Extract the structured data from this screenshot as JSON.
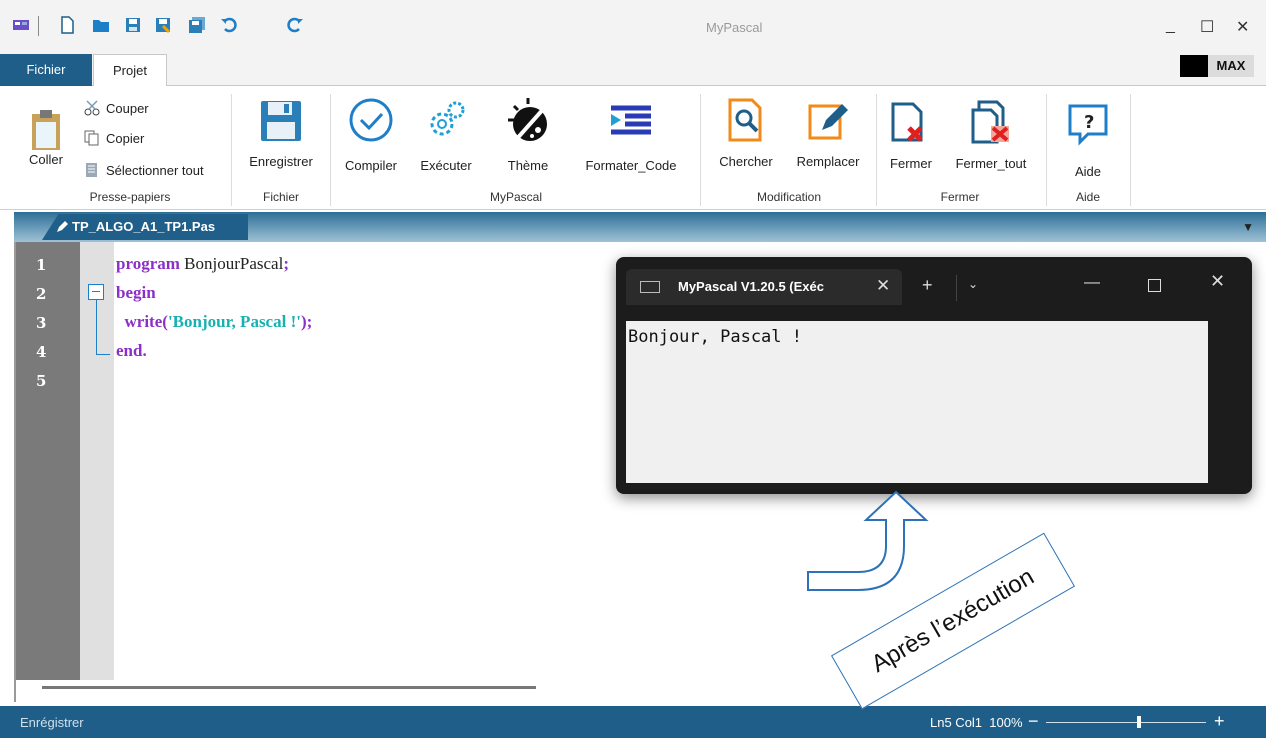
{
  "window": {
    "title": "MyPascal",
    "max_label": "MAX",
    "controls": {
      "minimize": "_",
      "maximize": "☐",
      "close": "✕"
    }
  },
  "quick_access": [
    {
      "name": "app-logo-icon"
    },
    {
      "name": "new-file-icon"
    },
    {
      "name": "open-folder-icon"
    },
    {
      "name": "save-icon"
    },
    {
      "name": "save-as-icon"
    },
    {
      "name": "save-all-icon"
    },
    {
      "name": "undo-icon"
    },
    {
      "name": "redo-icon"
    }
  ],
  "menu_tabs": {
    "fichier": "Fichier",
    "projet": "Projet"
  },
  "ribbon": {
    "clipboard": {
      "coller": "Coller",
      "couper": "Couper",
      "copier": "Copier",
      "selectionner": "Sélectionner tout",
      "group": "Presse-papiers"
    },
    "fichier": {
      "enregistrer": "Enregistrer",
      "group": "Fichier"
    },
    "mypascal": {
      "compiler": "Compiler",
      "executer": "Exécuter",
      "theme": "Thème",
      "formater": "Formater_Code",
      "group": "MyPascal"
    },
    "modification": {
      "chercher": "Chercher",
      "remplacer": "Remplacer",
      "group": "Modification"
    },
    "fermer": {
      "fermer": "Fermer",
      "fermer_tout": "Fermer_tout",
      "group": "Fermer"
    },
    "aide": {
      "aide": "Aide",
      "group": "Aide"
    }
  },
  "document_tab": {
    "filename": "TP_ALGO_A1_TP1.Pas"
  },
  "editor": {
    "line_numbers": [
      "1",
      "2",
      "3",
      "4",
      "5"
    ],
    "code": {
      "l1_kw": "program",
      "l1_id": " BonjourPascal",
      "l1_pun": ";",
      "l2_kw": "begin",
      "l3_kw": "  write",
      "l3_p1": "(",
      "l3_str": "'Bonjour, Pascal !'",
      "l3_p2": ");",
      "l4_kw": "end",
      "l4_pun": "."
    }
  },
  "status_bar": {
    "left": "Enrégistrer",
    "position": "Ln5 Col1",
    "zoom": "100%",
    "zoom_level": 0.58
  },
  "terminal": {
    "tab_title": "MyPascal V1.20.5 (Exéc",
    "output": "Bonjour, Pascal !"
  },
  "annotation": {
    "text": "Après l’exécution"
  },
  "colors": {
    "accent": "#1e5e88",
    "keyword": "#8b2fc9",
    "string": "#1ab0b0",
    "annotation_border": "#2d72b8"
  }
}
